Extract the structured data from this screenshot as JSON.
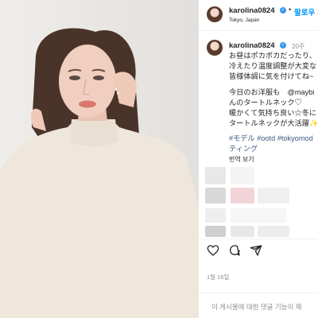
{
  "post": {
    "username": "karolina0824",
    "location": "Tokyo, Japan",
    "follow_label": "팔로우",
    "time_ago": "20주",
    "caption_lines": [
      "お昼はポカポカだったり、",
      "冷えたり温度調整が大変な",
      "皆様体調に気を付けてね~",
      "",
      "今日のお洋服も　@maybi",
      "んのタートルネック♡",
      "暖かくて気持ち良い☆冬に",
      "タートルネックが大活躍✨"
    ],
    "hashtags_line1": "#モデル #ootd #tokyomod",
    "hashtags_line2": "ティング",
    "translate_label": "번역 보기",
    "date": "1월 16일",
    "comments_disabled": "이 게시물에 대한 댓글 기능이 제"
  },
  "icons": [
    "heart-icon",
    "comment-icon",
    "share-icon",
    "verified-badge-icon"
  ],
  "colors": {
    "link_blue": "#0095f6",
    "hashtag": "#3d5a80",
    "muted": "#8e8e8e"
  }
}
